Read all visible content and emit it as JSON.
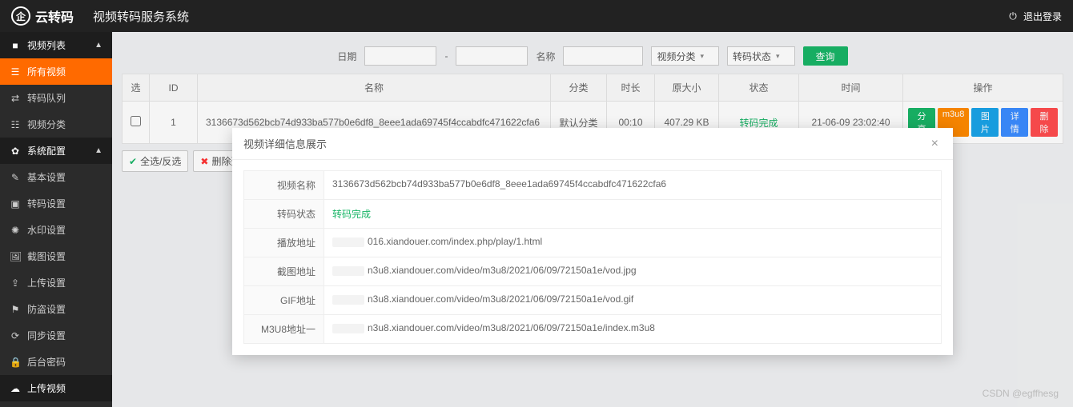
{
  "top": {
    "brand_text": "云转码",
    "logo_glyph": "企",
    "system_title": "视频转码服务系统",
    "logout": "退出登录"
  },
  "sidebar": {
    "groups": [
      {
        "label": "视频列表",
        "icon": "■",
        "chev": "▲"
      },
      {
        "label": "所有视频",
        "icon": "☰",
        "active": true
      },
      {
        "label": "转码队列",
        "icon": "⇄"
      },
      {
        "label": "视频分类",
        "icon": "☷"
      },
      {
        "label": "系统配置",
        "icon": "✿",
        "chev": "▲"
      },
      {
        "label": "基本设置",
        "icon": "✎"
      },
      {
        "label": "转码设置",
        "icon": "▣"
      },
      {
        "label": "水印设置",
        "icon": "✺"
      },
      {
        "label": "截图设置",
        "icon": "🖼"
      },
      {
        "label": "上传设置",
        "icon": "⇪"
      },
      {
        "label": "防盗设置",
        "icon": "⚑"
      },
      {
        "label": "同步设置",
        "icon": "⟳"
      },
      {
        "label": "后台密码",
        "icon": "🔒"
      },
      {
        "label": "上传视频",
        "icon": "☁",
        "chev": ""
      }
    ]
  },
  "filters": {
    "date_label": "日期",
    "date_sep": "-",
    "name_label": "名称",
    "cat_select": "视频分类",
    "status_select": "转码状态",
    "query": "查询"
  },
  "table": {
    "headers": {
      "sel": "选",
      "id": "ID",
      "name": "名称",
      "cat": "分类",
      "dur": "时长",
      "size": "原大小",
      "status": "状态",
      "time": "时间",
      "ops": "操作"
    },
    "row": {
      "id": "1",
      "name": "3136673d562bcb74d933ba577b0e6df8_8eee1ada69745f4ccabdfc471622cfa6",
      "cat": "默认分类",
      "dur": "00:10",
      "size": "407.29 KB",
      "status": "转码完成",
      "time": "21-06-09 23:02:40"
    },
    "ops": {
      "share": "分享",
      "m3u8": "m3u8",
      "pic": "图片",
      "detail": "详情",
      "del": "删除"
    }
  },
  "bulk": {
    "select_all": "全选/反选",
    "del_sel": "删除选中"
  },
  "modal": {
    "title": "视频详细信息展示",
    "rows": [
      {
        "label": "视频名称",
        "value": "3136673d562bcb74d933ba577b0e6df8_8eee1ada69745f4ccabdfc471622cfa6",
        "green": false
      },
      {
        "label": "转码状态",
        "value": "转码完成",
        "green": true
      },
      {
        "label": "播放地址",
        "prefix_hidden": true,
        "value": "016.xiandouer.com/index.php/play/1.html"
      },
      {
        "label": "截图地址",
        "prefix_hidden": true,
        "value": "n3u8.xiandouer.com/video/m3u8/2021/06/09/72150a1e/vod.jpg"
      },
      {
        "label": "GIF地址",
        "prefix_hidden": true,
        "value": "n3u8.xiandouer.com/video/m3u8/2021/06/09/72150a1e/vod.gif"
      },
      {
        "label": "M3U8地址一",
        "prefix_hidden": true,
        "value": "n3u8.xiandouer.com/video/m3u8/2021/06/09/72150a1e/index.m3u8"
      }
    ]
  },
  "watermark": "CSDN @egffhesg"
}
